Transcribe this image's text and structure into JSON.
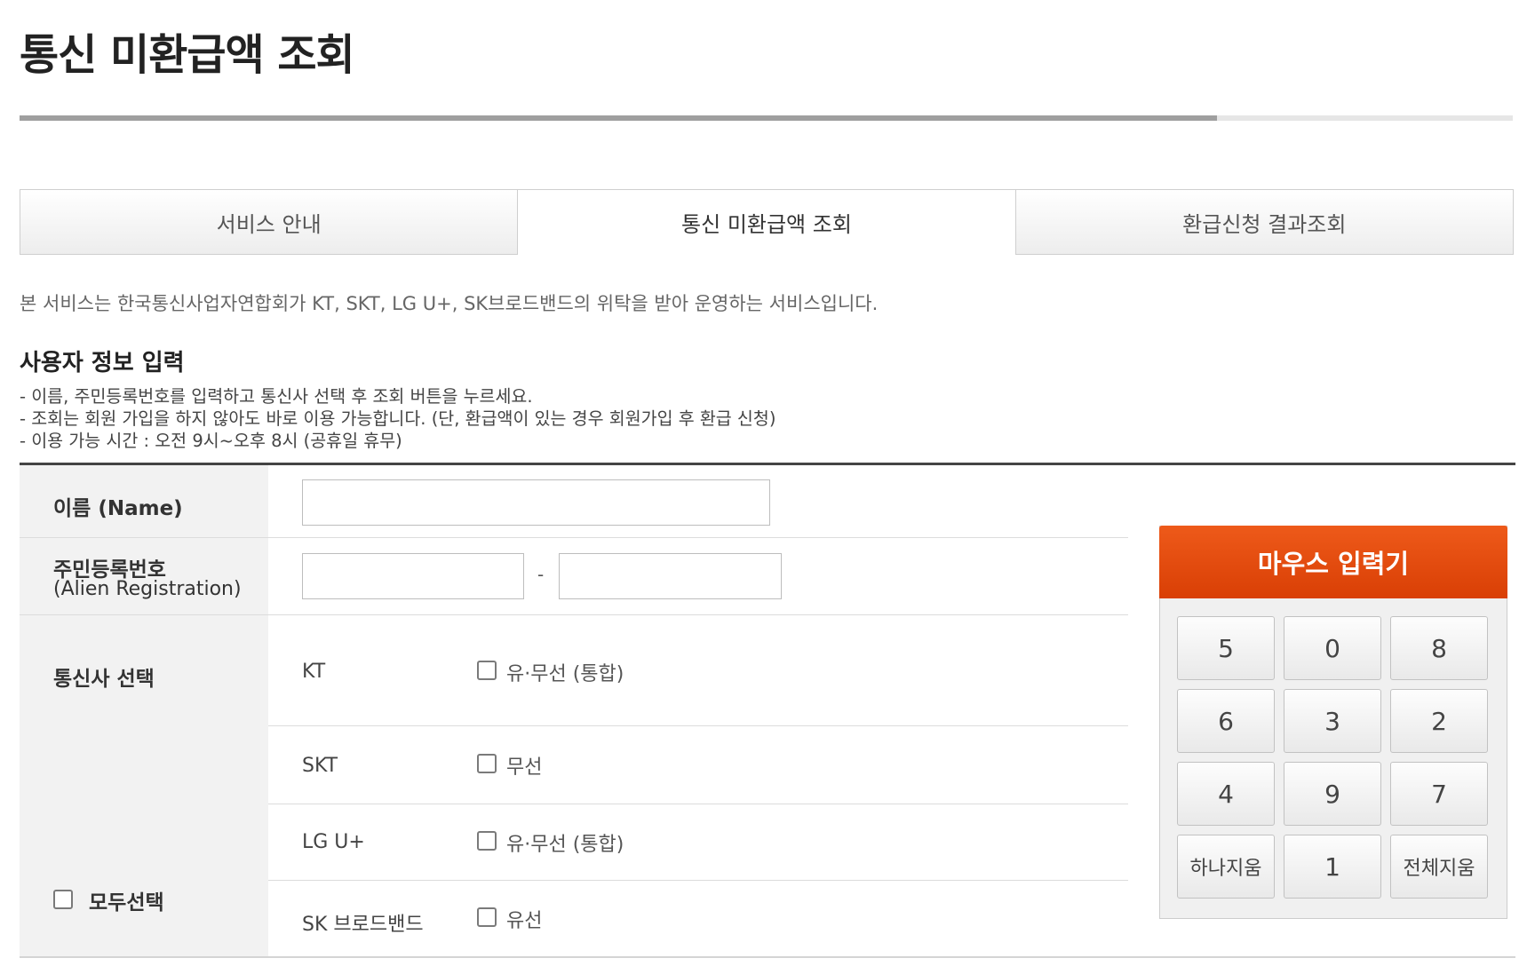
{
  "page": {
    "title": "통신 미환급액 조회",
    "progress_percent": 80
  },
  "tabs": [
    {
      "label": "서비스 안내",
      "active": false
    },
    {
      "label": "통신 미환급액 조회",
      "active": true
    },
    {
      "label": "환급신청 결과조회",
      "active": false
    }
  ],
  "service_note": "본 서비스는 한국통신사업자연합회가 KT, SKT, LG U+, SK브로드밴드의 위탁을 받아 운영하는 서비스입니다.",
  "section_title": "사용자 정보 입력",
  "instructions": [
    "- 이름, 주민등록번호를 입력하고 통신사 선택 후 조회 버튼을 누르세요.",
    "- 조회는 회원 가입을 하지 않아도 바로 이용 가능합니다. (단, 환급액이 있는 경우 회원가입 후 환급 신청)",
    "- 이용 가능 시간 : 오전 9시~오후 8시 (공휴일 휴무)"
  ],
  "form": {
    "name_label": "이름 (Name)",
    "name_value": "",
    "id_label": "주민등록번호",
    "id_sublabel": "(Alien Registration)",
    "id_separator": "-",
    "id_front_value": "",
    "id_back_value": "",
    "carrier_label": "통신사 선택",
    "select_all_label": "모두선택",
    "carriers": [
      {
        "name": "KT",
        "option": "유·무선 (통합)",
        "checked": false
      },
      {
        "name": "SKT",
        "option": "무선",
        "checked": false
      },
      {
        "name": "LG U+",
        "option": "유·무선 (통합)",
        "checked": false
      },
      {
        "name": "SK 브로드밴드",
        "option": "유선",
        "checked": false
      }
    ]
  },
  "keypad": {
    "title": "마우스 입력기",
    "keys": [
      "5",
      "0",
      "8",
      "6",
      "3",
      "2",
      "4",
      "9",
      "7",
      "하나지움",
      "1",
      "전체지움"
    ]
  },
  "colors": {
    "keypad_header": "#e04a0c",
    "form_topline": "#444444",
    "label_background": "#f2f2f2"
  }
}
